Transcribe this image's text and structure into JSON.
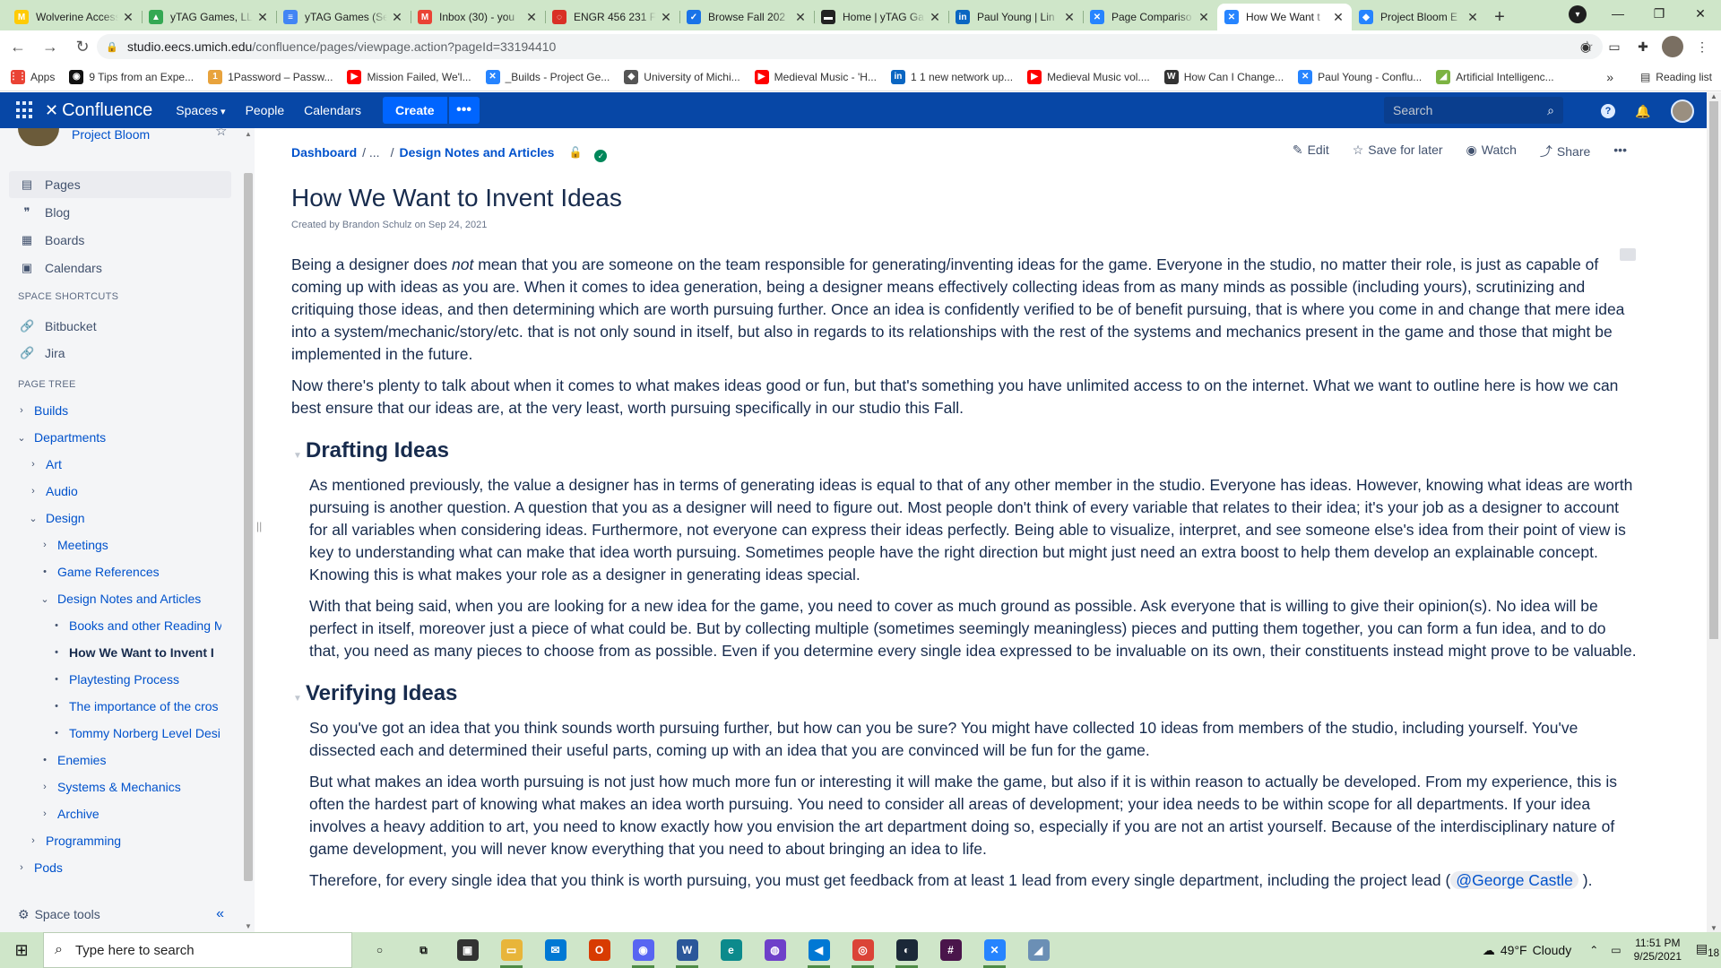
{
  "browser": {
    "tabs": [
      {
        "title": "Wolverine Access",
        "icon": "M",
        "color": "#ffcb05"
      },
      {
        "title": "yTAG Games, LLC",
        "icon": "▲",
        "color": "#34a853"
      },
      {
        "title": "yTAG Games (Se",
        "icon": "≡",
        "color": "#4285f4"
      },
      {
        "title": "Inbox (30) - you",
        "icon": "M",
        "color": "#ea4335"
      },
      {
        "title": "ENGR 456 231 F",
        "icon": "◌",
        "color": "#d93025"
      },
      {
        "title": "Browse Fall 202",
        "icon": "✓",
        "color": "#1a73e8"
      },
      {
        "title": "Home | yTAG Ga",
        "icon": "▬",
        "color": "#222222"
      },
      {
        "title": "Paul Young | Lin",
        "icon": "in",
        "color": "#0a66c2"
      },
      {
        "title": "Page Compariso",
        "icon": "✕",
        "color": "#2684ff"
      },
      {
        "title": "How We Want t",
        "icon": "✕",
        "color": "#2684ff",
        "active": true
      },
      {
        "title": "Project Bloom E",
        "icon": "◆",
        "color": "#2684ff"
      }
    ],
    "url_host": "studio.eecs.umich.edu",
    "url_path": "/confluence/pages/viewpage.action?pageId=33194410",
    "bookmarks": [
      {
        "label": "Apps",
        "icon": "⋮⋮",
        "color": "#ea4335"
      },
      {
        "label": "9 Tips from an Expe...",
        "icon": "◉",
        "color": "#111111"
      },
      {
        "label": "1Password – Passw...",
        "icon": "1",
        "color": "#e8a33d"
      },
      {
        "label": "Mission Failed, We'l...",
        "icon": "▶",
        "color": "#ff0000"
      },
      {
        "label": "_Builds - Project Ge...",
        "icon": "✕",
        "color": "#2684ff"
      },
      {
        "label": "University of Michi...",
        "icon": "◆",
        "color": "#555555"
      },
      {
        "label": "Medieval Music - 'H...",
        "icon": "▶",
        "color": "#ff0000"
      },
      {
        "label": "1 1 new network up...",
        "icon": "in",
        "color": "#0a66c2"
      },
      {
        "label": "Medieval Music vol....",
        "icon": "▶",
        "color": "#ff0000"
      },
      {
        "label": "How Can I Change...",
        "icon": "W",
        "color": "#333333"
      },
      {
        "label": "Paul Young - Conflu...",
        "icon": "✕",
        "color": "#2684ff"
      },
      {
        "label": "Artificial Intelligenc...",
        "icon": "◢",
        "color": "#7cb342"
      }
    ],
    "bookmarks_more": "»",
    "reading_list": "Reading list"
  },
  "confluence": {
    "logo": "Confluence",
    "nav": {
      "spaces": "Spaces",
      "people": "People",
      "calendars": "Calendars"
    },
    "create": "Create",
    "more": "•••",
    "search_placeholder": "Search"
  },
  "sidebar": {
    "space_name": "Project Bloom",
    "nav": [
      {
        "label": "Pages",
        "icon": "▤",
        "selected": true
      },
      {
        "label": "Blog",
        "icon": "❞"
      },
      {
        "label": "Boards",
        "icon": "▦"
      },
      {
        "label": "Calendars",
        "icon": "▣"
      }
    ],
    "shortcuts_title": "SPACE SHORTCUTS",
    "shortcuts": [
      {
        "label": "Bitbucket"
      },
      {
        "label": "Jira"
      }
    ],
    "tree_title": "PAGE TREE",
    "tree": [
      {
        "label": "Builds",
        "level": 0,
        "tw": "›"
      },
      {
        "label": "Departments",
        "level": 0,
        "tw": "⌄"
      },
      {
        "label": "Art",
        "level": 1,
        "tw": "›"
      },
      {
        "label": "Audio",
        "level": 1,
        "tw": "›"
      },
      {
        "label": "Design",
        "level": 1,
        "tw": "⌄"
      },
      {
        "label": "Meetings",
        "level": 2,
        "tw": "›"
      },
      {
        "label": "Game References",
        "level": 2,
        "tw": "•"
      },
      {
        "label": "Design Notes and Articles",
        "level": 2,
        "tw": "⌄"
      },
      {
        "label": "Books and other Reading M",
        "level": 3,
        "tw": "•"
      },
      {
        "label": "How We Want to Invent I",
        "level": 3,
        "tw": "•",
        "current": true
      },
      {
        "label": "Playtesting Process",
        "level": 3,
        "tw": "•"
      },
      {
        "label": "The importance of the cros",
        "level": 3,
        "tw": "•"
      },
      {
        "label": "Tommy Norberg Level Desi",
        "level": 3,
        "tw": "•"
      },
      {
        "label": "Enemies",
        "level": 2,
        "tw": "•"
      },
      {
        "label": "Systems & Mechanics",
        "level": 2,
        "tw": "›"
      },
      {
        "label": "Archive",
        "level": 2,
        "tw": "›"
      },
      {
        "label": "Programming",
        "level": 1,
        "tw": "›"
      },
      {
        "label": "Pods",
        "level": 0,
        "tw": "›"
      }
    ],
    "space_tools": "Space tools"
  },
  "page": {
    "breadcrumb_root": "Dashboard",
    "breadcrumb_ellipsis": "/ ...",
    "breadcrumb_sep": "/",
    "breadcrumb_parent": "Design Notes and Articles",
    "actions": {
      "edit": "Edit",
      "save": "Save for later",
      "watch": "Watch",
      "share": "Share",
      "more": "•••"
    },
    "title": "How We Want to Invent Ideas",
    "byline": "Created by Brandon Schulz on Sep 24, 2021",
    "intro_p1_a": "Being a designer does ",
    "intro_p1_em": "not",
    "intro_p1_b": " mean that you are someone on the team responsible for generating/inventing ideas for the game. Everyone in the studio, no matter their role, is just as capable of coming up with ideas as you are. When it comes to idea generation, being a designer means effectively collecting ideas from as many minds as possible (including yours), scrutinizing and critiquing those ideas, and then determining which are worth pursuing further. Once an idea is confidently verified to be of benefit pursuing, that is where you come in and change that mere idea into a system/mechanic/story/etc. that is not only sound in itself, but also in regards to its relationships with the rest of the systems and mechanics present in the game and those that might be implemented in the future.",
    "intro_p2": "Now there's plenty to talk about when it comes to what makes ideas good or fun, but that's something you have unlimited access to on the internet. What we want to outline here is how we can best ensure that our ideas are, at the very least, worth pursuing specifically in our studio this Fall.",
    "h_drafting": "Drafting Ideas",
    "drafting_p1": "As mentioned previously, the value a designer has in terms of generating ideas is equal to that of any other member in the studio. Everyone has ideas. However, knowing what ideas are worth pursuing is another question. A question that you as a designer will need to figure out. Most people don't think of every variable that relates to their idea; it's your job as a designer to account for all variables when considering ideas. Furthermore, not everyone can express their ideas perfectly. Being able to visualize, interpret, and see someone else's idea from their point of view is key to understanding what can make that idea worth pursuing. Sometimes people have the right direction but might just need an extra boost to help them develop an explainable concept. Knowing this is what makes your role as a designer in generating ideas special.",
    "drafting_p2": "With that being said, when you are looking for a new idea for the game, you need to cover as much ground as possible. Ask everyone that is willing to give their opinion(s). No idea will be perfect in itself, moreover just a piece of what could be. But by collecting multiple (sometimes seemingly meaningless) pieces and putting them together, you can form a fun idea, and to do that, you need as many pieces to choose from as possible. Even if you determine every single idea expressed to be invaluable on its own, their constituents instead might prove to be valuable.",
    "h_verifying": "Verifying Ideas",
    "verifying_p1": "So you've got an idea that you think sounds worth pursuing further, but how can you be sure? You might have collected 10 ideas from members of the studio, including yourself. You've dissected each and determined their useful parts, coming up with an idea that you are convinced will be fun for the game.",
    "verifying_p2": "But what makes an idea worth pursuing is not just how much more fun or interesting it will make the game, but also if it is within reason to actually be developed. From my experience, this is often the hardest part of knowing what makes an idea worth pursuing. You need to consider all areas of development; your idea needs to be within scope for all departments. If your idea involves a heavy addition to art, you need to know exactly how you envision the art department doing so, especially if you are not an artist yourself. Because of the interdisciplinary nature of game development, you will never know everything that you need to about bringing an idea to life.",
    "verifying_p3_a": "Therefore, for every single idea that you think is worth pursuing, you must get feedback from at least 1 lead from every single department, including the project lead (",
    "verifying_mention": "@George Castle",
    "verifying_p3_b": " )."
  },
  "taskbar": {
    "search_placeholder": "Type here to search",
    "apps": [
      {
        "name": "cortana",
        "g": "○",
        "color": "#cfe6c9",
        "fg": "#111111"
      },
      {
        "name": "task-view",
        "g": "⧉",
        "color": "#cfe6c9",
        "fg": "#111111"
      },
      {
        "name": "store",
        "g": "▣",
        "color": "#333333"
      },
      {
        "name": "explorer",
        "g": "▭",
        "color": "#e8b53a",
        "run": true
      },
      {
        "name": "mail",
        "g": "✉",
        "color": "#0078d4"
      },
      {
        "name": "office",
        "g": "O",
        "color": "#d83b01"
      },
      {
        "name": "discord",
        "g": "◉",
        "color": "#5865f2",
        "run": true
      },
      {
        "name": "word",
        "g": "W",
        "color": "#2b579a",
        "run": true
      },
      {
        "name": "edge",
        "g": "e",
        "color": "#0c8a8c"
      },
      {
        "name": "github",
        "g": "◍",
        "color": "#6e40c9"
      },
      {
        "name": "vscode",
        "g": "◀",
        "color": "#0078d4",
        "run": true
      },
      {
        "name": "chrome",
        "g": "◎",
        "color": "#db4437",
        "run": true
      },
      {
        "name": "steam",
        "g": "◐",
        "color": "#1b2838",
        "run": true
      },
      {
        "name": "slack",
        "g": "#",
        "color": "#4a154b"
      },
      {
        "name": "jira",
        "g": "✕",
        "color": "#2684ff",
        "run": true
      },
      {
        "name": "app",
        "g": "◢",
        "color": "#6b8fb5"
      }
    ],
    "weather_temp": "49°F",
    "weather_cond": "Cloudy",
    "time": "11:51 PM",
    "date": "9/25/2021",
    "notif_count": "18"
  }
}
